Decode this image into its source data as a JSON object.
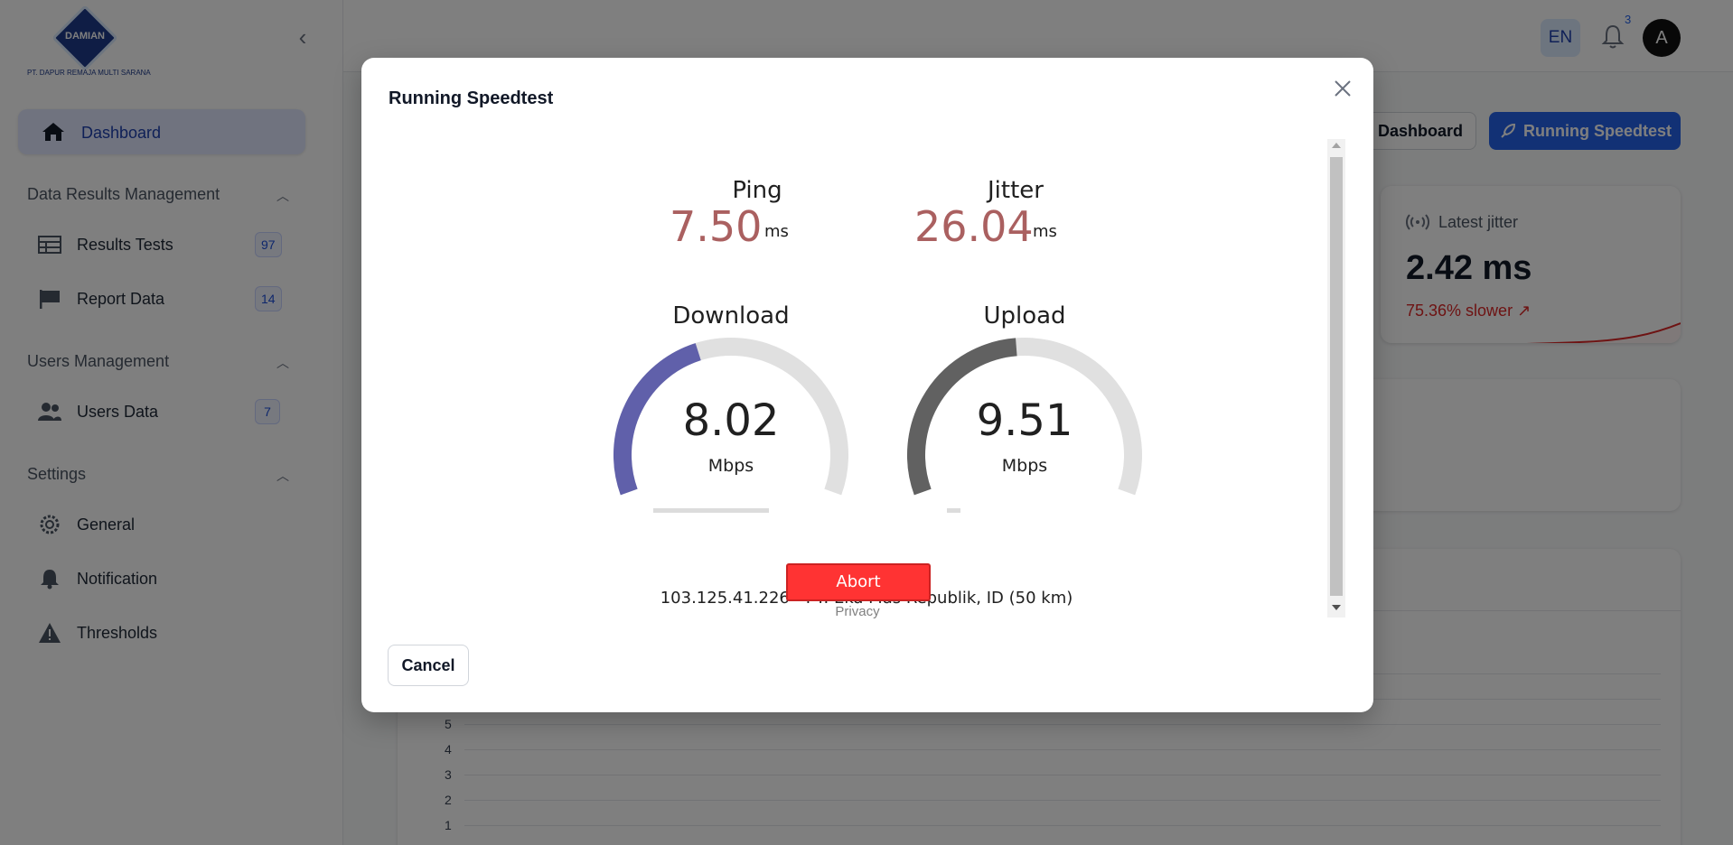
{
  "logo": {
    "brand": "DAMIAN",
    "company": "PT. DAPUR REMAJA MULTI SARANA"
  },
  "sidebar": {
    "active": {
      "label": "Dashboard",
      "icon": "home-icon"
    },
    "groups": [
      {
        "title": "Data Results Management",
        "items": [
          {
            "label": "Results Tests",
            "count": "97",
            "icon": "table-icon"
          },
          {
            "label": "Report Data",
            "count": "14",
            "icon": "flag-icon"
          }
        ]
      },
      {
        "title": "Users Management",
        "items": [
          {
            "label": "Users Data",
            "count": "7",
            "icon": "users-icon"
          }
        ]
      },
      {
        "title": "Settings",
        "items": [
          {
            "label": "General",
            "icon": "gear-icon"
          },
          {
            "label": "Notification",
            "icon": "bell-icon"
          },
          {
            "label": "Thresholds",
            "icon": "warning-icon"
          }
        ]
      }
    ]
  },
  "header": {
    "lang": "EN",
    "notification_count": "3",
    "avatar_initial": "A"
  },
  "page": {
    "btn_dashboard": "Dashboard",
    "btn_speedtest": "Running Speedtest",
    "jitter_card": {
      "title": "Latest jitter",
      "value": "2.42 ms",
      "delta": "75.36% slower"
    },
    "chart_yticks": [
      "5",
      "4",
      "3",
      "2",
      "1"
    ]
  },
  "modal": {
    "title": "Running Speedtest",
    "ping": {
      "label": "Ping",
      "value": "7.50",
      "unit": "ms"
    },
    "jitter": {
      "label": "Jitter",
      "value": "26.04",
      "unit": "ms"
    },
    "download": {
      "label": "Download",
      "value": "8.02",
      "unit": "Mbps",
      "gauge_fraction": 0.42,
      "progress": 0.85
    },
    "upload": {
      "label": "Upload",
      "value": "9.51",
      "unit": "Mbps",
      "gauge_fraction": 0.48,
      "progress": 0.1
    },
    "server": "103.125.41.226 - PT. Eka Mas Republik, ID (50 km)",
    "abort_label": "Abort",
    "privacy_label": "Privacy",
    "cancel_label": "Cancel",
    "colors": {
      "download": "#6060aa",
      "upload": "#616161",
      "track": "#e0e0e0",
      "value": "#aa6060",
      "abort": "#ff3333"
    }
  }
}
